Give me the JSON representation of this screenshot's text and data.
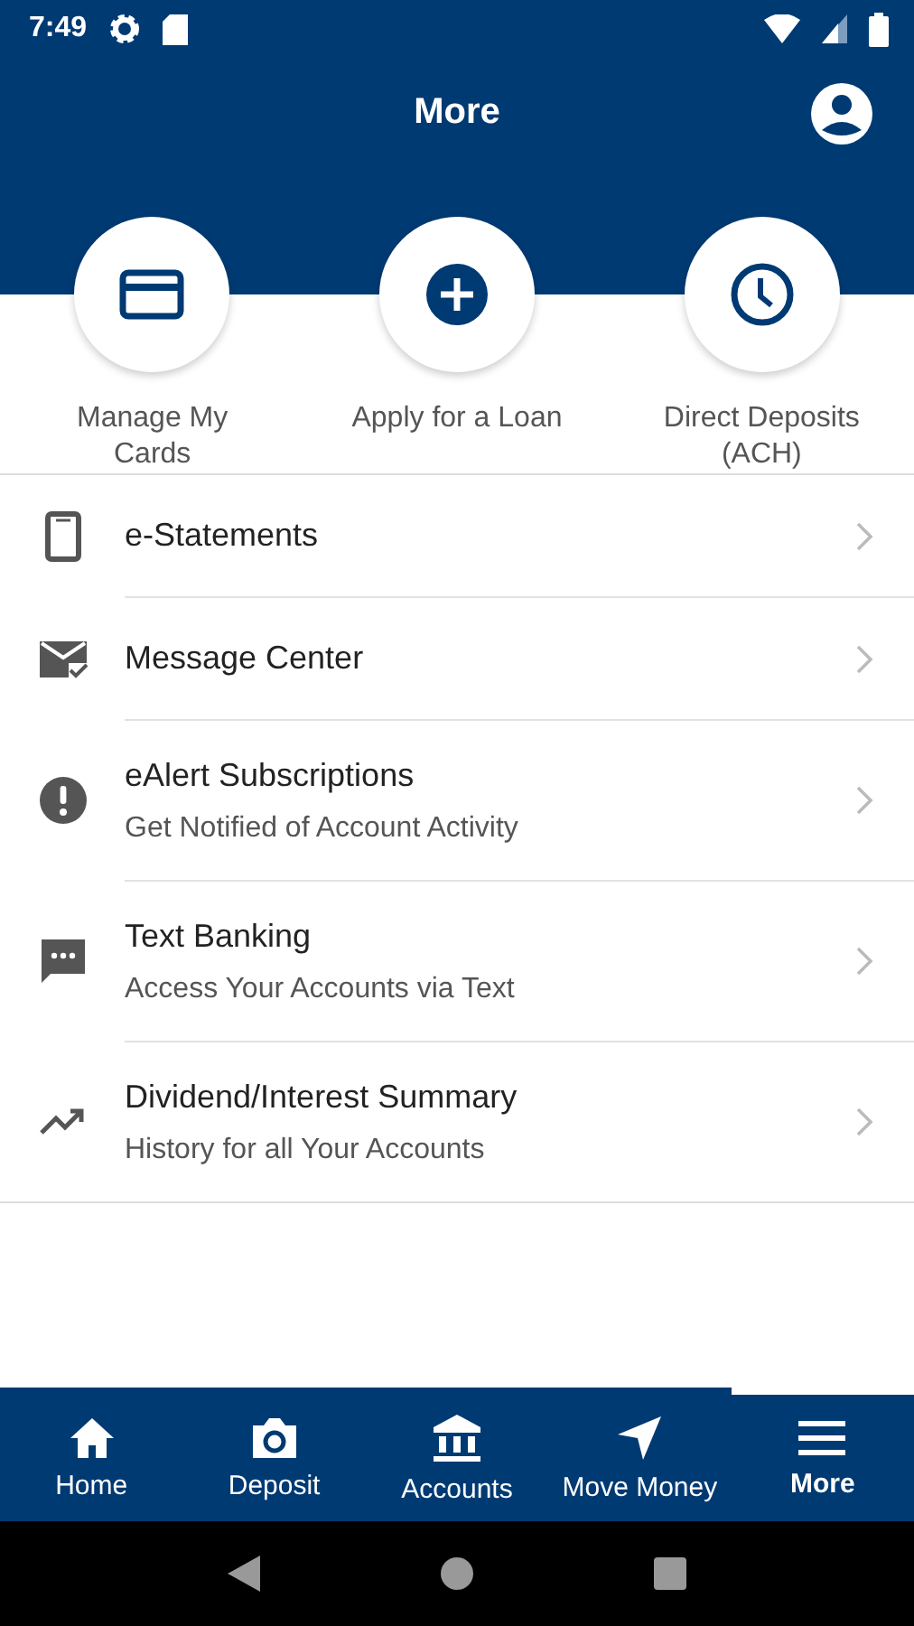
{
  "status_bar": {
    "time": "7:49"
  },
  "header": {
    "title": "More"
  },
  "quick_actions": [
    {
      "label": "Manage My Cards"
    },
    {
      "label": "Apply for a Loan"
    },
    {
      "label": "Direct Deposits (ACH)"
    }
  ],
  "menu": [
    {
      "title": "e-Statements"
    },
    {
      "title": "Message Center"
    },
    {
      "title": "eAlert Subscriptions",
      "subtitle": "Get Notified of Account Activity"
    },
    {
      "title": "Text Banking",
      "subtitle": "Access Your Accounts via Text"
    },
    {
      "title": "Dividend/Interest Summary",
      "subtitle": "History for all Your Accounts"
    }
  ],
  "bottom_nav": [
    {
      "label": "Home",
      "selected": false
    },
    {
      "label": "Deposit",
      "selected": false
    },
    {
      "label": "Accounts",
      "selected": false
    },
    {
      "label": "Move Money",
      "selected": false
    },
    {
      "label": "More",
      "selected": true
    }
  ]
}
